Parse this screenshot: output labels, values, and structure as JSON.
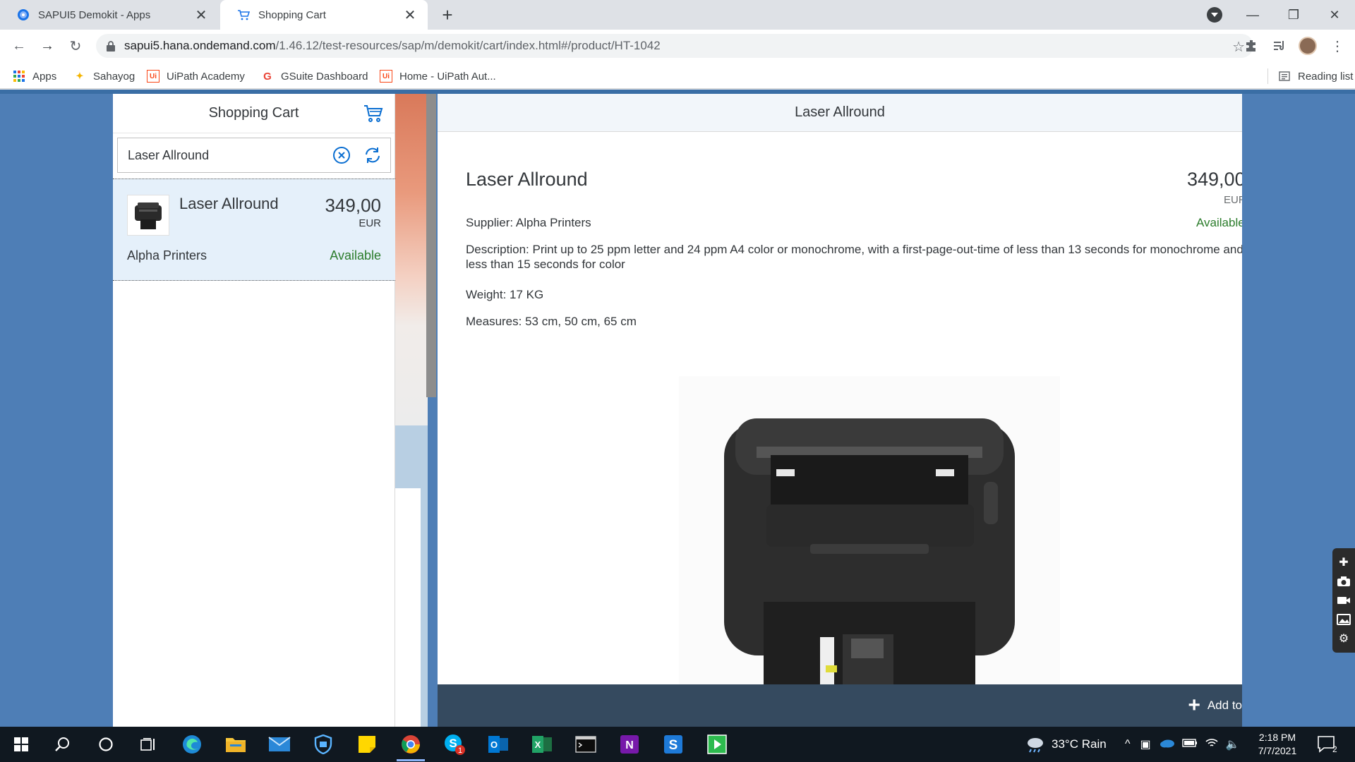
{
  "browser": {
    "tabs": [
      {
        "title": "SAPUI5 Demokit - Apps",
        "active": false
      },
      {
        "title": "Shopping Cart",
        "active": true
      }
    ],
    "new_tab_label": "+",
    "url": {
      "host": "sapui5.hana.ondemand.com",
      "path": "/1.46.12/test-resources/sap/m/demokit/cart/index.html#/product/HT-1042"
    },
    "bookmarks": [
      {
        "label": "Apps",
        "icon": "apps-grid-icon"
      },
      {
        "label": "Sahayog",
        "icon": "sahayog-icon"
      },
      {
        "label": "UiPath Academy",
        "icon": "uipath-icon"
      },
      {
        "label": "GSuite Dashboard",
        "icon": "google-icon"
      },
      {
        "label": "Home - UiPath Aut...",
        "icon": "uipath-icon"
      }
    ],
    "reading_list": "Reading list"
  },
  "master": {
    "title": "Shopping Cart",
    "search_value": "Laser Allround",
    "items": [
      {
        "name": "Laser Allround",
        "price": "349,00",
        "currency": "EUR",
        "supplier": "Alpha Printers",
        "status": "Available"
      }
    ]
  },
  "detail": {
    "header": "Laser Allround",
    "title": "Laser Allround",
    "price": "349,00",
    "currency": "EUR",
    "supplier": "Supplier: Alpha Printers",
    "status": "Available",
    "description": "Description: Print up to 25 ppm letter and 24 ppm A4 color or monochrome, with a first-page-out-time of less than 13 seconds for monochrome and less than 15 seconds for color",
    "weight": "Weight: 17 KG",
    "measures": "Measures: 53 cm, 50 cm, 65 cm",
    "add_button": "Add to"
  },
  "taskbar": {
    "weather": "33°C  Rain",
    "time": "2:18 PM",
    "date": "7/7/2021",
    "notification_count": "2",
    "skype_badge": "1"
  },
  "colors": {
    "success": "#2b7c2b",
    "shell_bg": "#4e7eb6",
    "footer": "#354a5f",
    "list_selected": "#e5f0fa"
  }
}
